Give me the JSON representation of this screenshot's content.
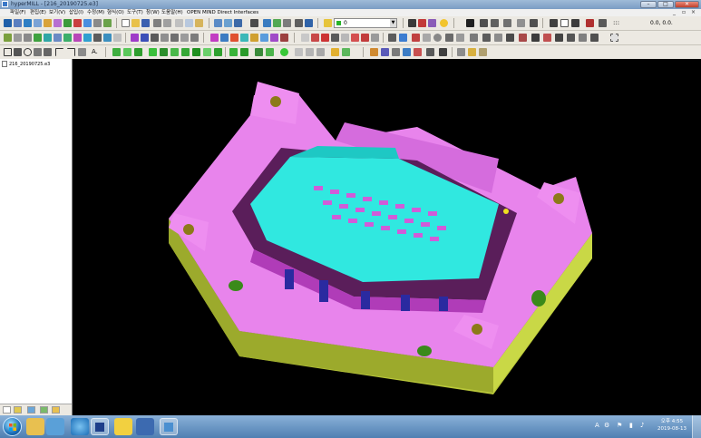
{
  "window": {
    "title": "hyperMILL - [216_20190725.e3]",
    "buttons": {
      "minimize": "–",
      "maximize": "□",
      "close": "✕"
    }
  },
  "menu": {
    "items": [
      "파일(F)",
      "편집(E)",
      "보기(V)",
      "삽입(I)",
      "수정(M)",
      "형식(O)",
      "도구(T)",
      "창(W)",
      "도움말(H)",
      "OPEN MIND Direct Interfaces"
    ]
  },
  "toolbar": {
    "text_tool": "A.",
    "line_style_value": "0",
    "snap_readout": "0.0, 0.0."
  },
  "document_tree": {
    "file_name": "216_20190725.e3"
  },
  "taskbar": {
    "tray_lang": "A",
    "time": "오후 4:55",
    "date": "2019-08-13"
  },
  "colors": {
    "mold_base": "#e884ec",
    "cavity": "#30e8e0",
    "side_wall": "#c8d83c",
    "background": "#000000"
  }
}
